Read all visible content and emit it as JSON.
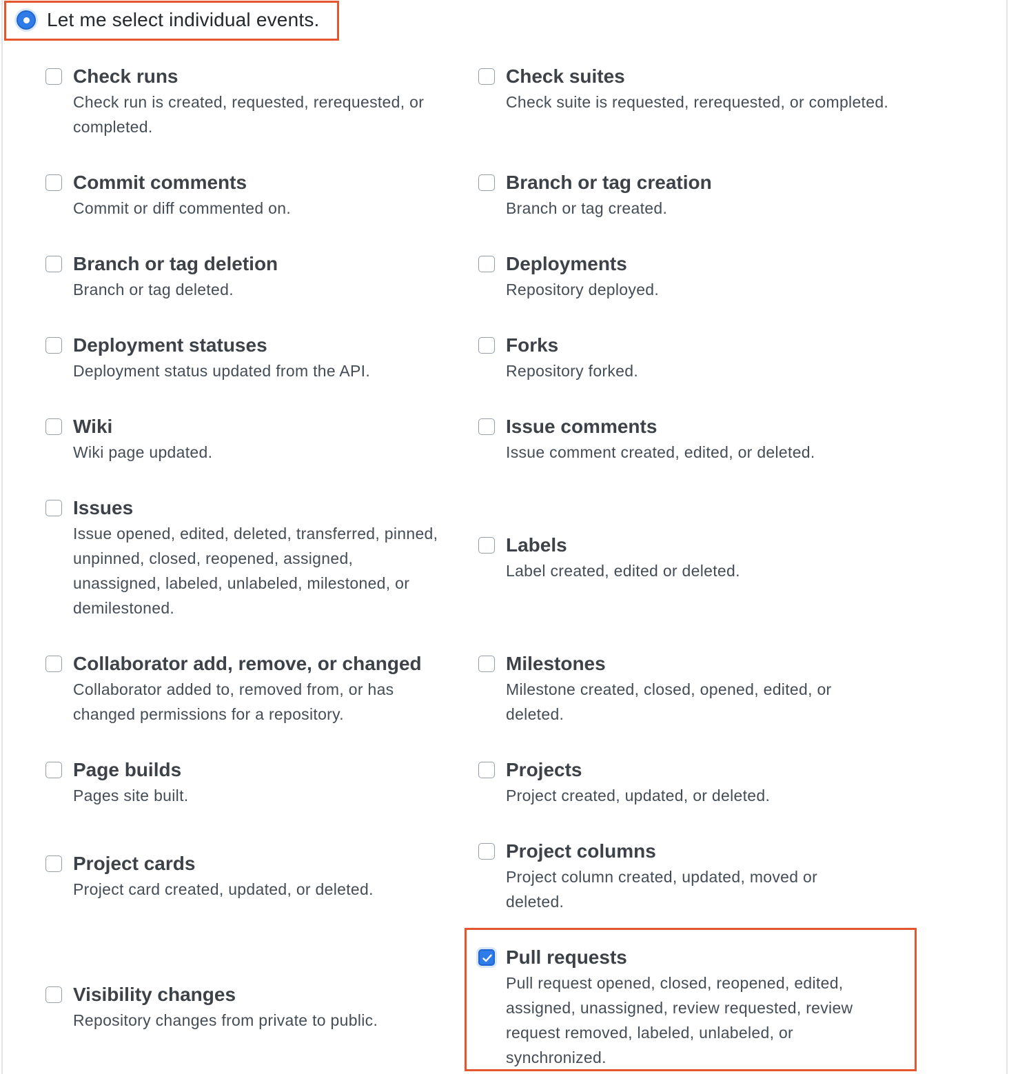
{
  "mode": {
    "label": "Let me select individual events.",
    "selected": true
  },
  "events": [
    {
      "id": "check-runs",
      "title": "Check runs",
      "desc": "Check run is created, requested, rerequested, or completed.",
      "checked": false
    },
    {
      "id": "check-suites",
      "title": "Check suites",
      "desc": "Check suite is requested, rerequested, or completed.",
      "checked": false
    },
    {
      "id": "commit-comments",
      "title": "Commit comments",
      "desc": "Commit or diff commented on.",
      "checked": false
    },
    {
      "id": "branch-tag-creation",
      "title": "Branch or tag creation",
      "desc": "Branch or tag created.",
      "checked": false
    },
    {
      "id": "branch-tag-deletion",
      "title": "Branch or tag deletion",
      "desc": "Branch or tag deleted.",
      "checked": false
    },
    {
      "id": "deployments",
      "title": "Deployments",
      "desc": "Repository deployed.",
      "checked": false
    },
    {
      "id": "deployment-statuses",
      "title": "Deployment statuses",
      "desc": "Deployment status updated from the API.",
      "checked": false
    },
    {
      "id": "forks",
      "title": "Forks",
      "desc": "Repository forked.",
      "checked": false
    },
    {
      "id": "wiki",
      "title": "Wiki",
      "desc": "Wiki page updated.",
      "checked": false
    },
    {
      "id": "issue-comments",
      "title": "Issue comments",
      "desc": "Issue comment created, edited, or deleted.",
      "checked": false
    },
    {
      "id": "issues",
      "title": "Issues",
      "desc": "Issue opened, edited, deleted, transferred, pinned, unpinned, closed, reopened, assigned, unassigned, labeled, unlabeled, milestoned, or demilestoned.",
      "checked": false
    },
    {
      "id": "labels",
      "title": "Labels",
      "desc": "Label created, edited or deleted.",
      "checked": false
    },
    {
      "id": "collaborator",
      "title": "Collaborator add, remove, or changed",
      "desc": "Collaborator added to, removed from, or has changed permissions for a repository.",
      "checked": false
    },
    {
      "id": "milestones",
      "title": "Milestones",
      "desc": "Milestone created, closed, opened, edited, or deleted.",
      "checked": false
    },
    {
      "id": "page-builds",
      "title": "Page builds",
      "desc": "Pages site built.",
      "checked": false
    },
    {
      "id": "projects",
      "title": "Projects",
      "desc": "Project created, updated, or deleted.",
      "checked": false
    },
    {
      "id": "project-cards",
      "title": "Project cards",
      "desc": "Project card created, updated, or deleted.",
      "checked": false
    },
    {
      "id": "project-columns",
      "title": "Project columns",
      "desc": "Project column created, updated, moved or deleted.",
      "checked": false
    },
    {
      "id": "visibility-changes",
      "title": "Visibility changes",
      "desc": "Repository changes from private to public.",
      "checked": false
    },
    {
      "id": "pull-requests",
      "title": "Pull requests",
      "desc": "Pull request opened, closed, reopened, edited, assigned, unassigned, review requested, review request removed, labeled, unlabeled, or synchronized.",
      "checked": true
    }
  ],
  "colors": {
    "accent": "#2f7ce9",
    "highlight": "#e4572e"
  }
}
